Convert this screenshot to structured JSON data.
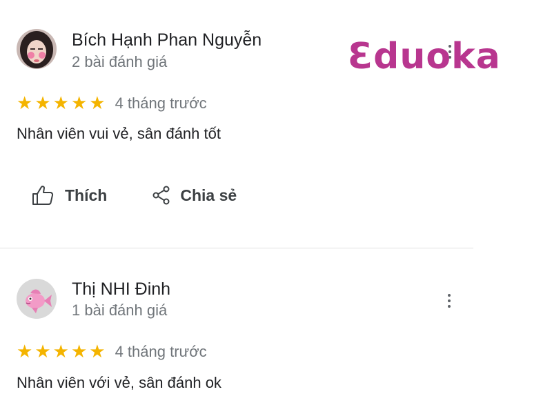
{
  "reviews": [
    {
      "author_name": "Bích Hạnh Phan Nguyễn",
      "author_meta": "2 bài đánh giá",
      "rating": 5,
      "stars": "★★★★★",
      "date": "4 tháng trước",
      "text": "Nhân viên vui vẻ, sân đánh tốt"
    },
    {
      "author_name": "Thị NHI Đinh",
      "author_meta": "1 bài đánh giá",
      "rating": 5,
      "stars": "★★★★★",
      "date": "4 tháng trước",
      "text": "Nhân viên với vẻ, sân đánh ok"
    }
  ],
  "actions": {
    "like_label": "Thích",
    "share_label": "Chia sẻ"
  },
  "watermark": {
    "text": "Ɛduoka"
  },
  "colors": {
    "star": "#f4b400",
    "logo": "#b8368f",
    "meta_text": "#70757a",
    "primary_text": "#202124"
  }
}
